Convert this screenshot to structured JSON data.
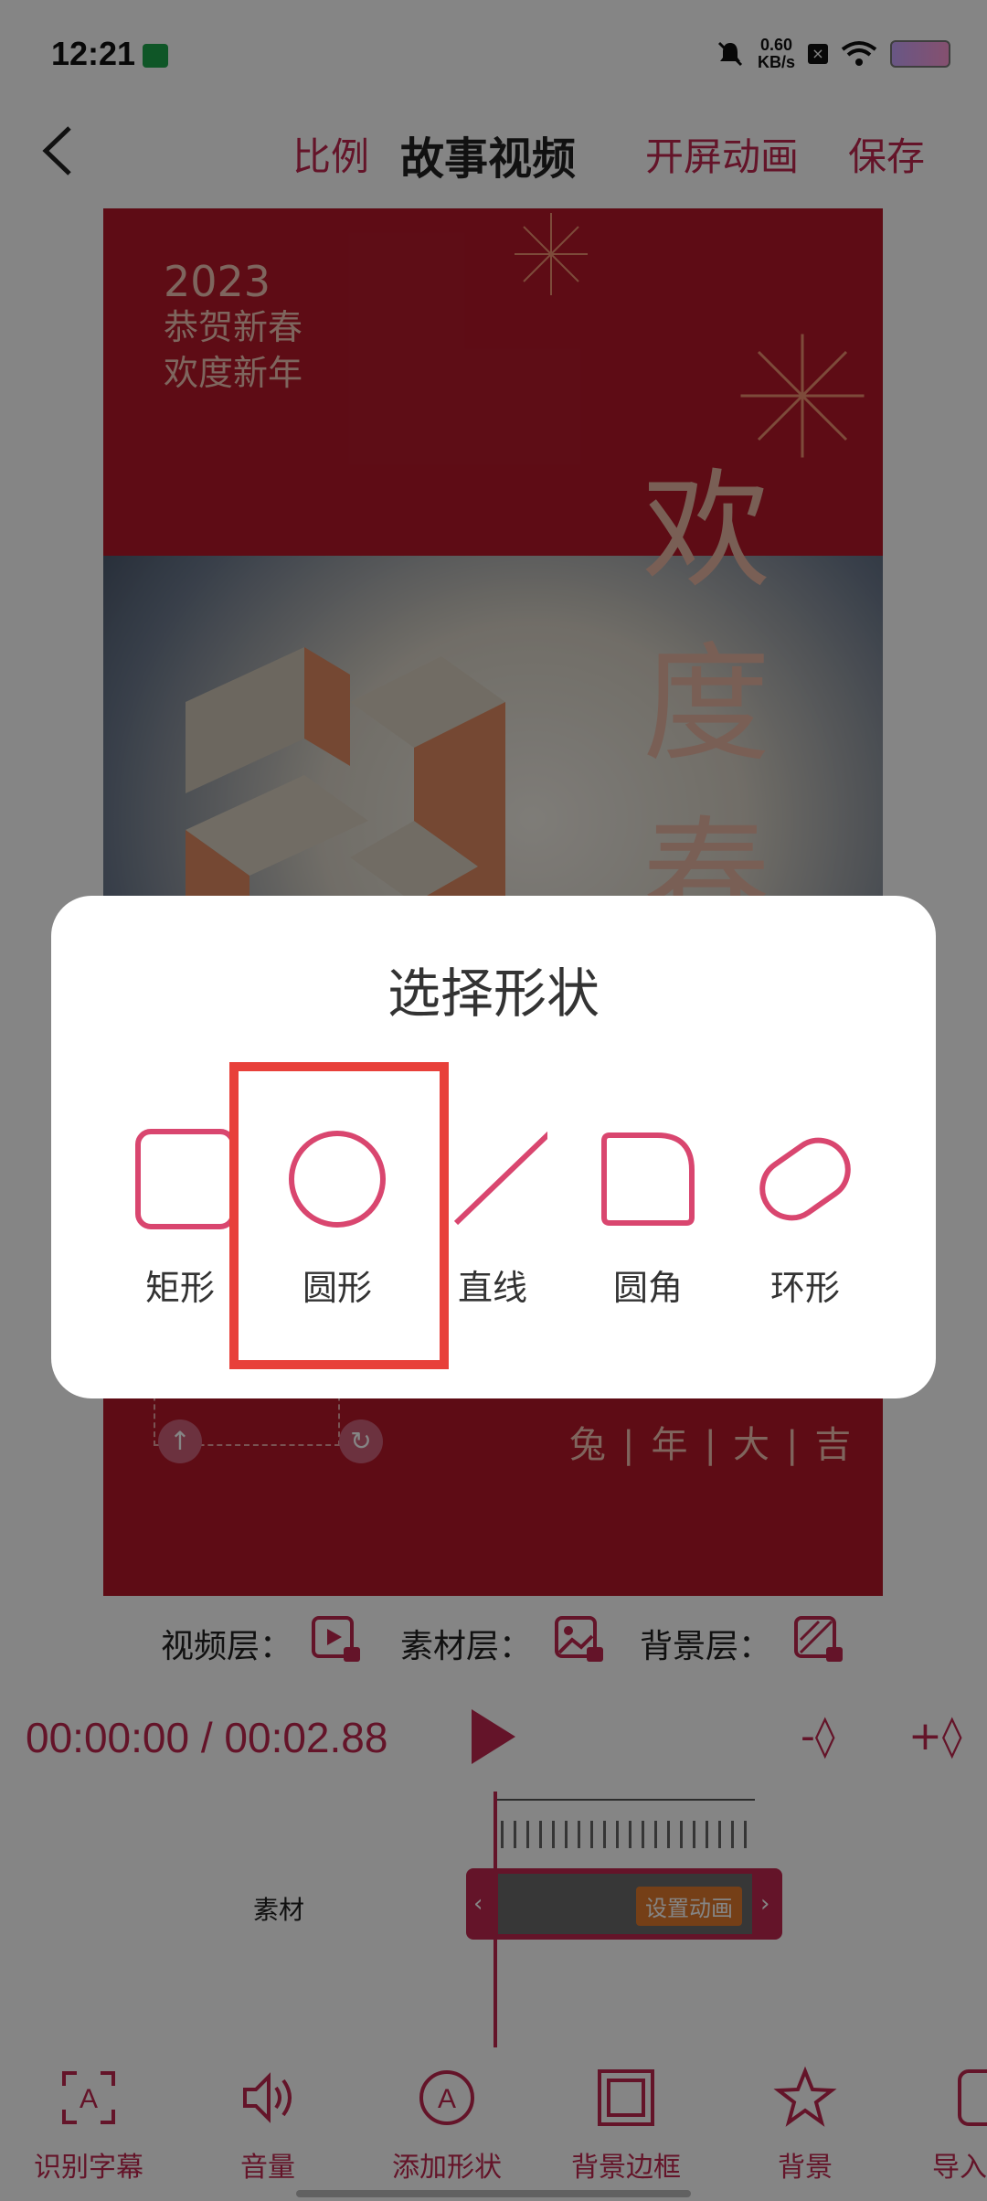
{
  "status_bar": {
    "time": "12:21",
    "net_speed_value": "0.60",
    "net_speed_unit": "KB/s"
  },
  "topbar": {
    "ratio": "比例",
    "title": "故事视频",
    "splash_animation": "开屏动画",
    "save": "保存"
  },
  "poster": {
    "year": "2023",
    "line1": "恭贺新春",
    "line2": "欢度新年",
    "vertical_chars": [
      "欢",
      "度",
      "春"
    ],
    "footer": "兔|年|大|吉"
  },
  "modal": {
    "title": "选择形状",
    "shapes": [
      {
        "label": "矩形",
        "icon": "rectangle-icon"
      },
      {
        "label": "圆形",
        "icon": "circle-icon"
      },
      {
        "label": "直线",
        "icon": "line-icon"
      },
      {
        "label": "圆角",
        "icon": "rounded-corner-icon"
      },
      {
        "label": "环形",
        "icon": "ring-icon"
      }
    ],
    "selected": "圆形"
  },
  "layers": {
    "video": "视频层：",
    "material": "素材层：",
    "background": "背景层："
  },
  "player": {
    "time": "00:00:00 / 00:02.88"
  },
  "timeline": {
    "track_label": "素材",
    "clip_button": "设置动画"
  },
  "toolbar": {
    "items": [
      {
        "label": "识别字幕",
        "icon": "subtitle-recognition-icon"
      },
      {
        "label": "音量",
        "icon": "volume-icon"
      },
      {
        "label": "添加形状",
        "icon": "add-shape-icon"
      },
      {
        "label": "背景边框",
        "icon": "background-frame-icon"
      },
      {
        "label": "背景",
        "icon": "star-icon"
      },
      {
        "label": "导入",
        "icon": "import-icon"
      }
    ]
  },
  "colors": {
    "accent": "#c0284f",
    "highlight": "#e8403a",
    "poster_red": "#b5182a"
  }
}
